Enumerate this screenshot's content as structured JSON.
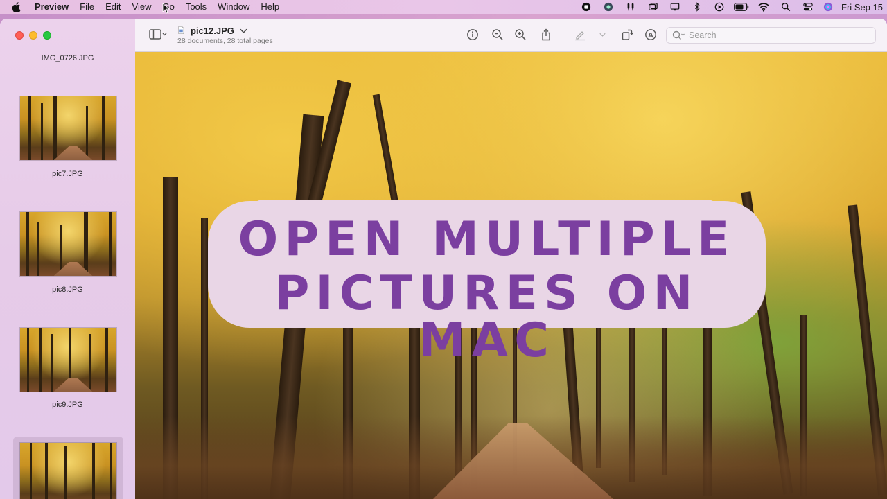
{
  "menubar": {
    "app_name": "Preview",
    "items": [
      "File",
      "Edit",
      "View",
      "Go",
      "Tools",
      "Window",
      "Help"
    ],
    "clock": "Fri Sep 15"
  },
  "window": {
    "document": {
      "title": "pic12.JPG",
      "subtitle": "28 documents, 28 total pages"
    },
    "search": {
      "placeholder": "Search"
    },
    "sidebar": {
      "top_caption": "IMG_0726.JPG",
      "thumbnails": [
        {
          "label": "pic7.JPG"
        },
        {
          "label": "pic8.JPG"
        },
        {
          "label": "pic9.JPG"
        },
        {
          "label": ""
        }
      ]
    },
    "overlay": {
      "line1": "OPEN MULTIPLE",
      "line2": "PICTURES ON MAC"
    }
  },
  "colors": {
    "overlay_bg": "#e9d6e6",
    "overlay_text": "#7b3fa0",
    "traffic_close": "#ff5f57",
    "traffic_min": "#febc2e",
    "traffic_max": "#28c840"
  },
  "icons": {
    "menubar_right": [
      "stop-record-icon",
      "app-icon",
      "airpods-icon",
      "window-icon",
      "display-icon",
      "bluetooth-icon",
      "play-icon",
      "battery-icon",
      "wifi-icon",
      "spotlight-icon",
      "control-center-icon",
      "siri-icon"
    ],
    "toolbar": [
      "sidebar-toggle-icon",
      "info-icon",
      "zoom-out-icon",
      "zoom-in-icon",
      "share-icon",
      "markup-pen-icon",
      "rotate-icon",
      "annotate-icon",
      "search-icon"
    ]
  }
}
